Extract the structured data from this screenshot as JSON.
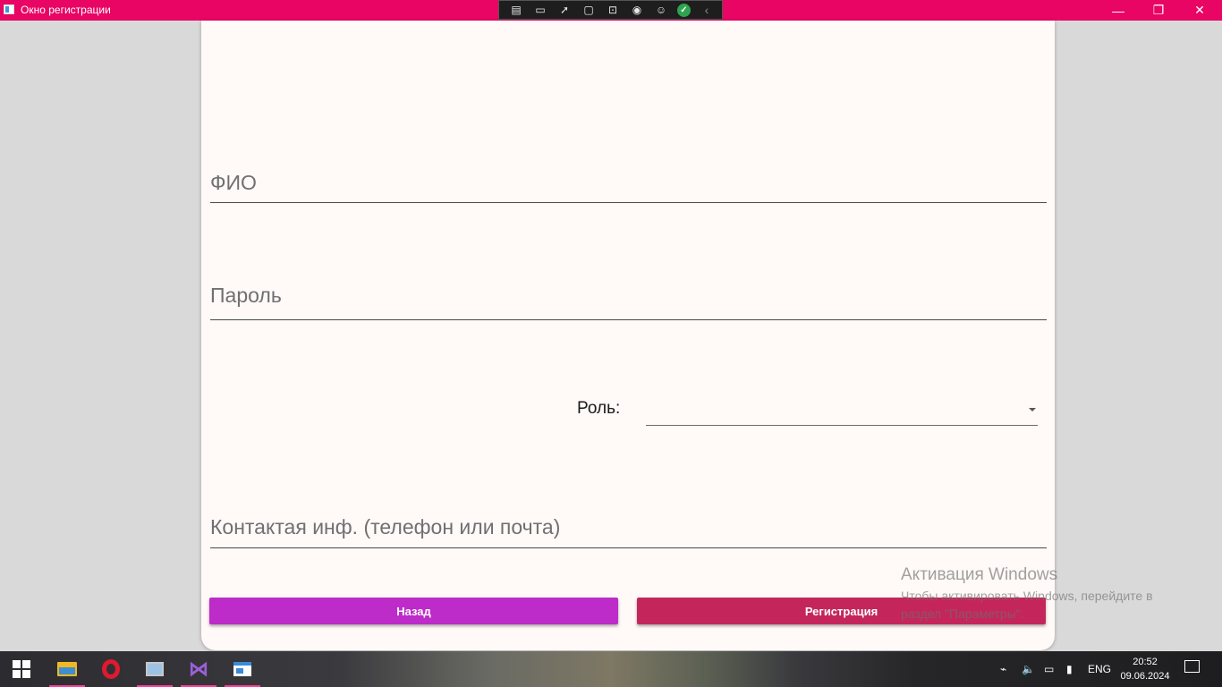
{
  "window": {
    "title": "Окно регистрации",
    "controls": {
      "minimize": "—",
      "restore": "❐",
      "close": "✕"
    }
  },
  "debug_toolbar": {
    "icons": [
      "visual-tree-icon",
      "record-icon",
      "select-element-icon",
      "track-focus-icon",
      "display-layout-icon",
      "hot-reload-icon",
      "accessibility-icon",
      "check-icon",
      "collapse-icon"
    ]
  },
  "form": {
    "full_name_placeholder": "ФИО",
    "password_placeholder": "Пароль",
    "role_label": "Роль:",
    "role_value": "",
    "contact_placeholder": "Контактая инф. (телефон или почта)",
    "back_button": "Назад",
    "register_button": "Регистрация"
  },
  "colors": {
    "titlebar": "#e80564",
    "back_button": "#bd2bc8",
    "register_button": "#c4265b"
  },
  "activation": {
    "title": "Активация Windows",
    "subtitle": "Чтобы активировать Windows, перейдите в раздел \"Параметры\"."
  },
  "taskbar": {
    "apps": [
      "file-explorer-icon",
      "opera-icon",
      "system-monitor-icon",
      "visual-studio-icon",
      "winforms-app-icon"
    ],
    "language": "ENG",
    "time": "20:52",
    "date": "09.06.2024"
  }
}
